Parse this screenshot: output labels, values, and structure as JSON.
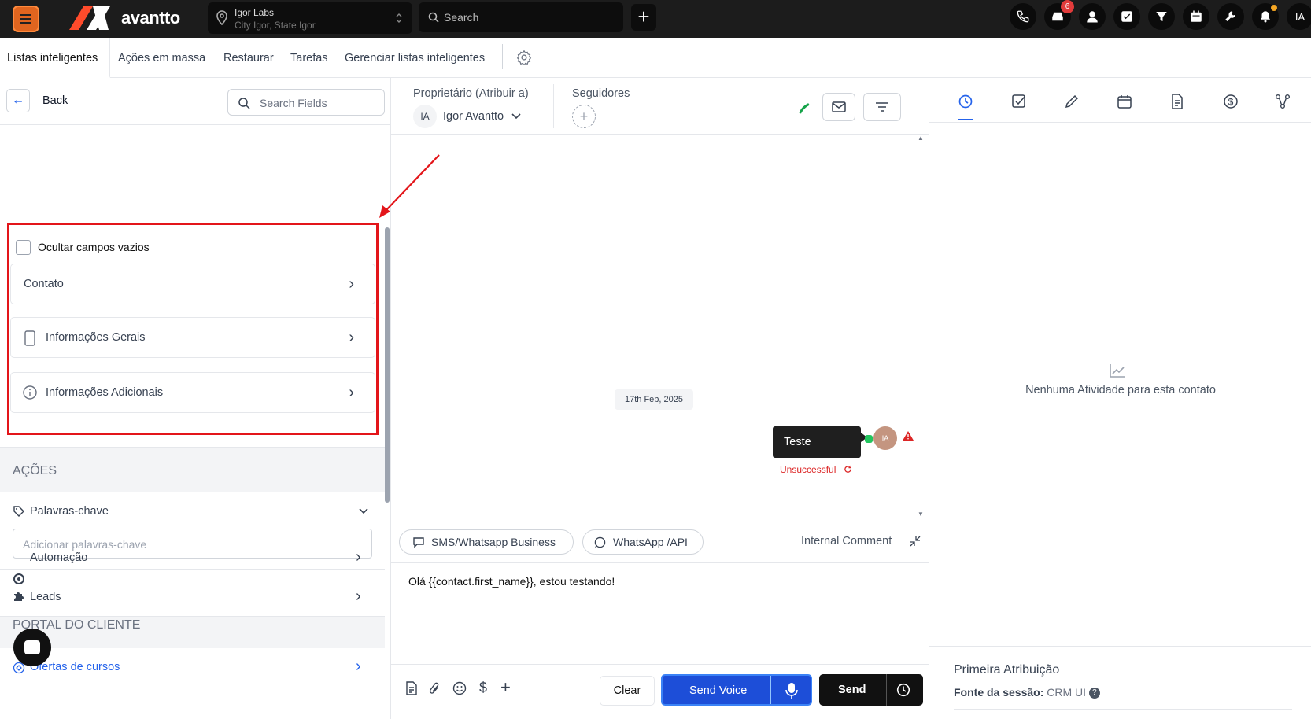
{
  "topbar": {
    "brand": "avantto",
    "location_name": "Igor Labs",
    "location_sub": "City Igor, State Igor",
    "search_placeholder": "Search",
    "notification_count": "6",
    "user_initials": "IA"
  },
  "subnav": {
    "items": [
      "Listas inteligentes",
      "Ações em massa",
      "Restaurar",
      "Tarefas",
      "Gerenciar listas inteligentes"
    ]
  },
  "left": {
    "back": "Back",
    "search_placeholder": "Search Fields",
    "hide_empty": "Ocultar campos vazios",
    "cards": [
      "Contato",
      "Informações Gerais",
      "Informações Adicionais"
    ],
    "actions_header": "AÇÕES",
    "keywords_label": "Palavras-chave",
    "keywords_placeholder": "Adicionar palavras-chave",
    "automation": "Automação",
    "leads": "Leads",
    "portal_header": "PORTAL DO CLIENTE",
    "courses": "Ofertas de cursos"
  },
  "mid": {
    "owner_label": "Proprietário (Atribuir a)",
    "owner_initials": "IA",
    "owner_name": "Igor Avantto",
    "followers_label": "Seguidores",
    "date": "17th Feb, 2025",
    "message": "Teste",
    "message_avatar": "IA",
    "message_status": "Unsuccessful",
    "channel_sms": "SMS/Whatsapp Business",
    "channel_whatsapp": "WhatsApp /API",
    "internal_comment": "Internal Comment",
    "compose_text": "Olá {{contact.first_name}}, estou testando!",
    "clear": "Clear",
    "send_voice": "Send Voice",
    "send": "Send"
  },
  "right": {
    "empty_text": "Nenhuma Atividade para esta contato",
    "attribution_title": "Primeira Atribuição",
    "session_label": "Fonte da sessão:",
    "session_value": "CRM UI"
  },
  "colors": {
    "accent": "#2563eb",
    "brand_orange": "#e0651f",
    "highlight_red": "#e3151a",
    "topbar": "#1c1c1c"
  }
}
